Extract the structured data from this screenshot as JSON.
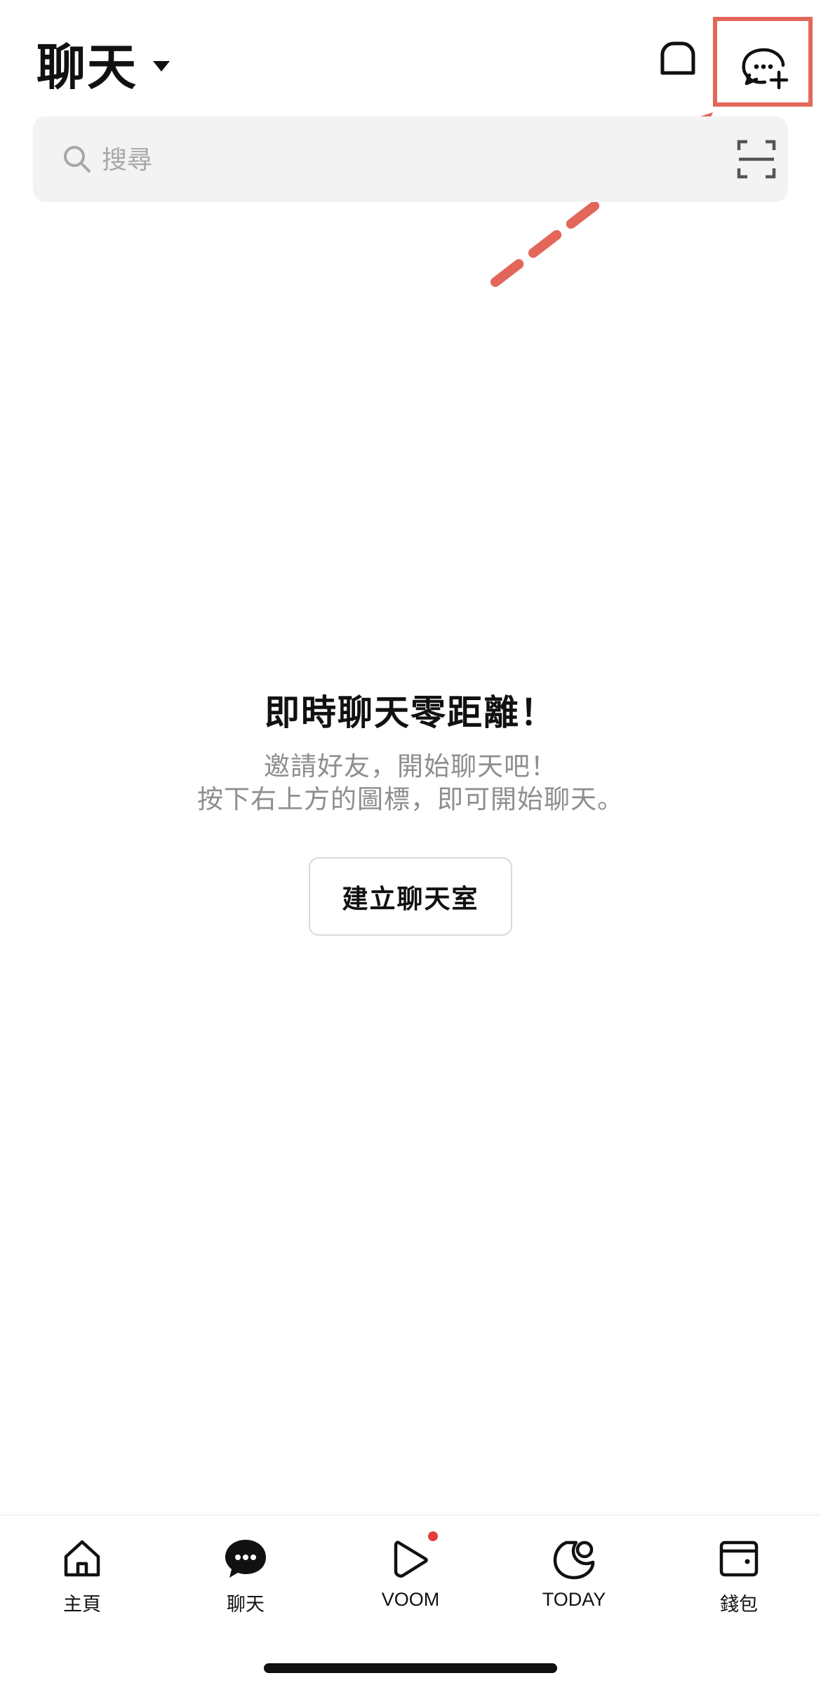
{
  "header": {
    "title": "聊天",
    "filter_icon": "chats-filter-icon",
    "new_chat_icon": "new-chat-icon"
  },
  "annotation": {
    "color": "#e2675a"
  },
  "search": {
    "placeholder": "搜尋",
    "value": "",
    "scan_icon": "qr-scan-icon"
  },
  "empty_state": {
    "title": "即時聊天零距離！",
    "line1": "邀請好友，開始聊天吧！",
    "line2": "按下右上方的圖標，即可開始聊天。",
    "button_label": "建立聊天室"
  },
  "bottom_nav": {
    "items": [
      {
        "label": "主頁",
        "icon": "home-icon"
      },
      {
        "label": "聊天",
        "icon": "chat-bubble-icon",
        "active": true
      },
      {
        "label": "VOOM",
        "icon": "voom-icon",
        "badge": "red-dot"
      },
      {
        "label": "TODAY",
        "icon": "today-icon"
      },
      {
        "label": "錢包",
        "icon": "wallet-icon"
      }
    ]
  },
  "colors": {
    "text": "#111111",
    "muted": "#8e8e8e",
    "search_bg": "#f3f3f3",
    "badge": "#e63b3b"
  }
}
